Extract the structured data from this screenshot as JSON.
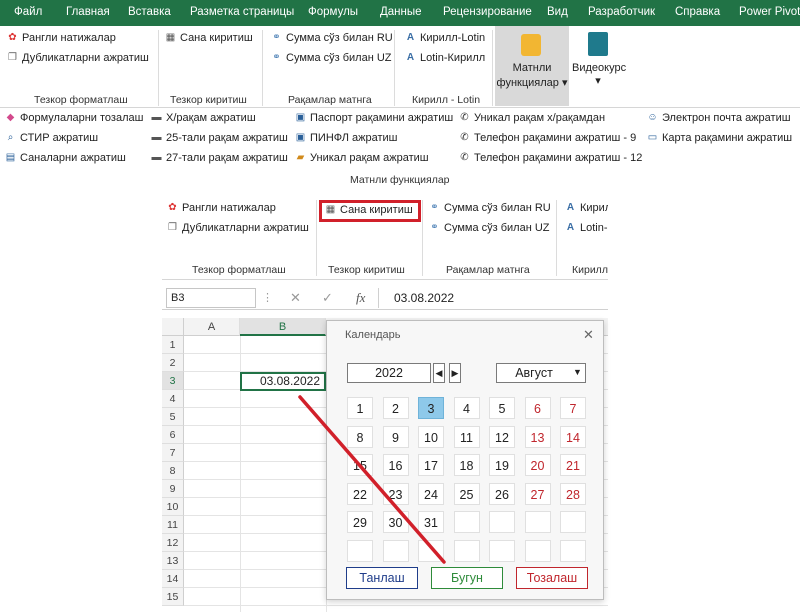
{
  "tabs": [
    "Файл",
    "Главная",
    "Вставка",
    "Разметка страницы",
    "Формулы",
    "Данные",
    "Рецензирование",
    "Вид",
    "Разработчик",
    "Справка",
    "Power Pivot"
  ],
  "ribbon": {
    "tezkor_formatlash": {
      "btn1": "Рангли натижалар",
      "btn2": "Дубликатларни ажратиш",
      "label": "Тезкор форматлаш"
    },
    "tezkor_kiritish": {
      "btn1": "Сана киритиш",
      "label": "Тезкор киритиш"
    },
    "raqamlar_matnga": {
      "btn1": "Сумма сўз билан RU",
      "btn2": "Сумма сўз билан UZ",
      "label": "Рақамлар матнга"
    },
    "kirill_lotin": {
      "btn1": "Кирилл-Lotin",
      "btn2": "Lotin-Кирилл",
      "label": "Кирилл - Lotin"
    },
    "matnli_funksiyalar": {
      "line1": "Матнли",
      "line2": "функциялар",
      "arrow": "▾"
    },
    "videokurs": {
      "label": "Видеокурс",
      "arrow": "▾"
    }
  },
  "ribbon2": {
    "col1": [
      "Формулаларни тозалаш",
      "СТИР ажратиш",
      "Саналарни ажратиш"
    ],
    "col2": [
      "Х/рақам ажратиш",
      "25-тали рақам ажратиш",
      "27-тали рақам ажратиш"
    ],
    "col3": [
      "Паспорт рақамини ажратиш",
      "ПИНФЛ ажратиш",
      "Уникал рақам ажратиш"
    ],
    "col4": [
      "Уникал рақам х/рақамдан",
      "Телефон рақамини ажратиш - 9",
      "Телефон рақамини ажратиш - 12"
    ],
    "col5": [
      "Электрон почта ажратиш",
      "Карта рақамини ажратиш"
    ],
    "label": "Матнли функциялар"
  },
  "crop": {
    "btn1": "Рангли натижалар",
    "btn2": "Дубликатларни ажратиш",
    "btn3": "Сана киритиш",
    "btn4": "Сумма сўз билан RU",
    "btn5": "Сумма сўз билан UZ",
    "btn6": "Кирил",
    "btn7": "Lotin-",
    "lbl1": "Тезкор форматлаш",
    "lbl2": "Тезкор киритиш",
    "lbl3": "Рақамлар матнга",
    "lbl4": "Кирилл"
  },
  "formula_bar": {
    "name_box": "B3",
    "fx": "fx",
    "value": "03.08.2022"
  },
  "sheet": {
    "columns": [
      "A",
      "B"
    ],
    "rows": [
      "1",
      "2",
      "3",
      "4",
      "5",
      "6",
      "7",
      "8",
      "9",
      "10",
      "11",
      "12",
      "13",
      "14",
      "15"
    ],
    "cell_b3": "03.08.2022"
  },
  "calendar": {
    "title": "Календарь",
    "close": "✕",
    "year": "2022",
    "month": "Август",
    "days": [
      "1",
      "2",
      "3",
      "4",
      "5",
      "6",
      "7",
      "8",
      "9",
      "10",
      "11",
      "12",
      "13",
      "14",
      "15",
      "16",
      "17",
      "18",
      "19",
      "20",
      "21",
      "22",
      "23",
      "24",
      "25",
      "26",
      "27",
      "28",
      "29",
      "30",
      "31"
    ],
    "selected_day": "3",
    "btn_select": "Танлаш",
    "btn_today": "Бугун",
    "btn_clear": "Тозалаш"
  },
  "colors": {
    "tabbar": "#217346",
    "highlight_box": "#d1202a",
    "arrow": "#d1202a",
    "weekend": "#c0262d",
    "selected": "#8ec9ea"
  }
}
